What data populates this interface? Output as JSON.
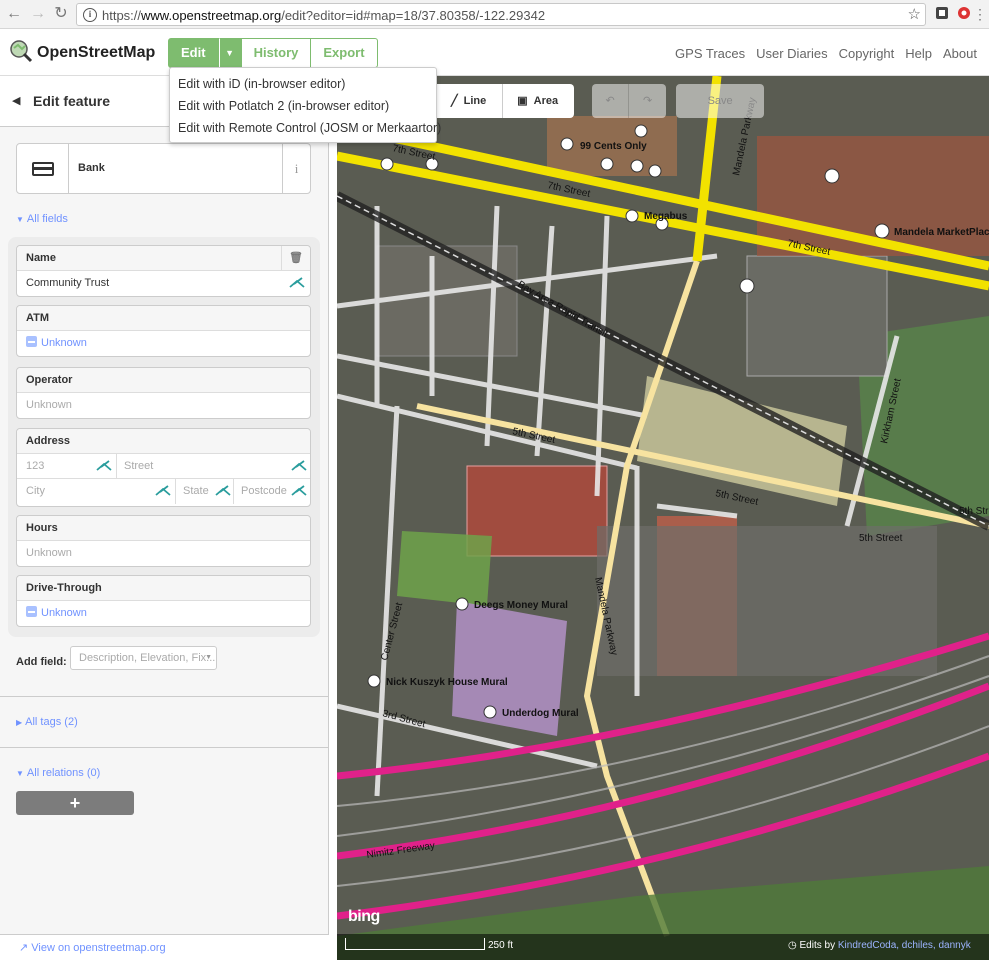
{
  "browser": {
    "url_prefix": "https://",
    "url_domain": "www.openstreetmap.org",
    "url_path": "/edit?editor=id#map=18/37.80358/-122.29342"
  },
  "osm": {
    "brand": "OpenStreetMap",
    "edit_label": "Edit",
    "history_label": "History",
    "export_label": "Export",
    "links": [
      "GPS Traces",
      "User Diaries",
      "Copyright",
      "Help",
      "About"
    ]
  },
  "dropdown": {
    "items": [
      "Edit with iD (in-browser editor)",
      "Edit with Potlatch 2 (in-browser editor)",
      "Edit with Remote Control (JOSM or Merkaartor)"
    ]
  },
  "sidebar": {
    "title": "Edit feature",
    "preset_name": "Bank",
    "all_fields": "All fields",
    "fields": {
      "name_label": "Name",
      "name_value": "Community Trust",
      "atm_label": "ATM",
      "atm_value": "Unknown",
      "operator_label": "Operator",
      "operator_placeholder": "Unknown",
      "address_label": "Address",
      "housenumber_placeholder": "123",
      "street_placeholder": "Street",
      "city_placeholder": "City",
      "state_placeholder": "State",
      "postcode_placeholder": "Postcode",
      "hours_label": "Hours",
      "hours_placeholder": "Unknown",
      "drivethrough_label": "Drive-Through",
      "drivethrough_value": "Unknown"
    },
    "add_field_label": "Add field:",
    "add_field_placeholder": "Description, Elevation, Fix...",
    "all_tags": "All tags (2)",
    "all_relations": "All relations (0)",
    "add_relation": "+",
    "view_on_osm": "View on openstreetmap.org"
  },
  "map": {
    "tools": {
      "line": "Line",
      "area": "Area",
      "save": "Save"
    },
    "streets": [
      "7th Street",
      "7th Street",
      "7th Street",
      "Mandela Parkway",
      "Mandela Parkway",
      "Bay Area Rapid Transit",
      "5th Street",
      "5th Street",
      "5th Street",
      "5th Street",
      "Kirkham Street",
      "Center Street",
      "3rd Street",
      "Nimitz Freeway"
    ],
    "pois": [
      "99 Cents Only",
      "Megabus",
      "Mandela MarketPlace",
      "Deegs Money Mural",
      "Nick Kuszyk House Mural",
      "Underdog Mural"
    ],
    "bing": "bing",
    "scale": "250 ft",
    "attribution_prefix": "Edits by ",
    "attribution_users": "KindredCoda, dchiles, dannyk"
  },
  "colors": {
    "osm_green": "#7ebc6f",
    "link_blue": "#7092ff",
    "road_yellow": "#f5e500",
    "freeway_pink": "#e0218a"
  }
}
